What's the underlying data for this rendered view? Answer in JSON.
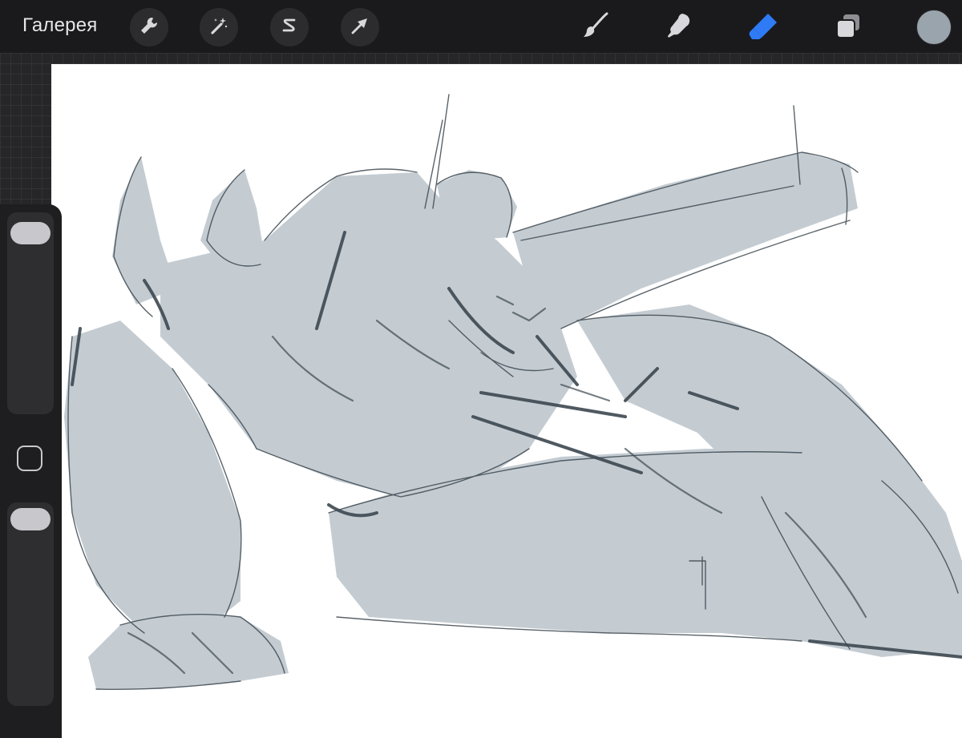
{
  "topbar": {
    "gallery_label": "Галерея",
    "left_tools": [
      {
        "name": "actions-tool",
        "icon": "wrench-icon"
      },
      {
        "name": "adjustments-tool",
        "icon": "magic-wand-icon"
      },
      {
        "name": "selection-tool",
        "icon": "selection-s-icon"
      },
      {
        "name": "transform-tool",
        "icon": "arrow-cursor-icon"
      }
    ],
    "right_tools": [
      {
        "name": "brush-tool",
        "icon": "brush-icon",
        "active": false
      },
      {
        "name": "smudge-tool",
        "icon": "smudge-finger-icon",
        "active": false
      },
      {
        "name": "eraser-tool",
        "icon": "eraser-icon",
        "active": true
      },
      {
        "name": "layers-tool",
        "icon": "layers-icon",
        "active": false
      }
    ],
    "current_color": "#9aa4ad"
  },
  "sidebar": {
    "brush_size_slider": {
      "level": 1.0
    },
    "opacity_slider": {
      "level": 1.0
    },
    "modify_button": {
      "icon": "square-modify-icon"
    }
  },
  "canvas": {
    "background": "#ffffff",
    "sketch_fill": "#c4ccd2",
    "sketch_stroke": "#3d4850"
  },
  "colors": {
    "accent": "#2f7bf6",
    "toolbar_bg": "#1a1a1c",
    "icon": "#d8d8dc"
  }
}
